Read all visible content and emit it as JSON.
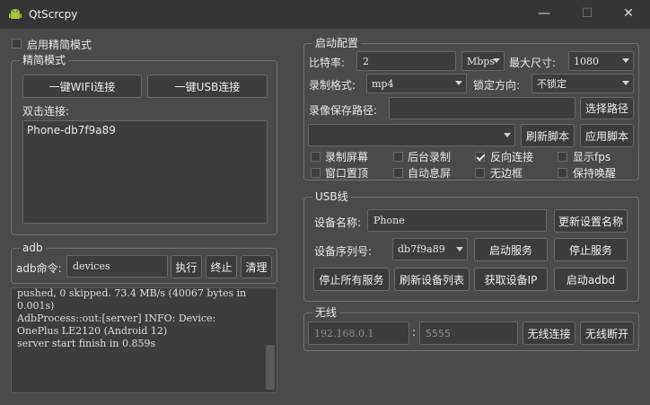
{
  "window": {
    "title": "QtScrcpy",
    "minimize": "—",
    "maximize": "☐",
    "close": "✕"
  },
  "simple_mode_checkbox": "启用精简模式",
  "simple": {
    "title": "精简模式",
    "wifi_button": "一键WIFI连接",
    "usb_button": "一键USB连接",
    "double_click_label": "双击连接:",
    "devices": [
      "Phone-db7f9a89"
    ]
  },
  "adb": {
    "title": "adb",
    "command_label": "adb命令:",
    "command_value": "devices",
    "execute": "执行",
    "stop": "终止",
    "clear": "清理"
  },
  "log": {
    "lines": [
      "pushed, 0 skipped. 73.4 MB/s (40067 bytes in",
      "0.001s)",
      "",
      "AdbProcess::out:[server] INFO: Device:",
      "OnePlus LE2120 (Android 12)",
      "",
      "server start finish in 0.859s"
    ]
  },
  "config": {
    "title": "启动配置",
    "bitrate_label": "比特率:",
    "bitrate_value": "2",
    "bitrate_unit": "Mbps",
    "maxsize_label": "最大尺寸:",
    "maxsize_value": "1080",
    "record_format_label": "录制格式:",
    "record_format_value": "mp4",
    "lock_orientation_label": "锁定方向:",
    "lock_orientation_value": "不锁定",
    "record_path_label": "录像保存路径:",
    "record_path_value": "",
    "select_path": "选择路径",
    "script_value": "",
    "refresh_script": "刷新脚本",
    "apply_script": "应用脚本",
    "options": [
      {
        "label": "录制屏幕",
        "checked": false
      },
      {
        "label": "后台录制",
        "checked": false
      },
      {
        "label": "反向连接",
        "checked": true
      },
      {
        "label": "显示fps",
        "checked": false
      },
      {
        "label": "窗口置顶",
        "checked": false
      },
      {
        "label": "自动息屏",
        "checked": false
      },
      {
        "label": "无边框",
        "checked": false
      },
      {
        "label": "保持唤醒",
        "checked": false
      }
    ]
  },
  "usb": {
    "title": "USB线",
    "device_name_label": "设备名称:",
    "device_name_value": "Phone",
    "update_name": "更新设置名称",
    "serial_label": "设备序列号:",
    "serial_value": "db7f9a89",
    "start_service": "启动服务",
    "stop_service": "停止服务",
    "stop_all": "停止所有服务",
    "refresh_devices": "刷新设备列表",
    "get_ip": "获取设备IP",
    "start_adbd": "启动adbd"
  },
  "wireless": {
    "title": "无线",
    "ip_placeholder": "192.168.0.1",
    "separator": ":",
    "port_placeholder": "5555",
    "connect": "无线连接",
    "disconnect": "无线断开"
  }
}
